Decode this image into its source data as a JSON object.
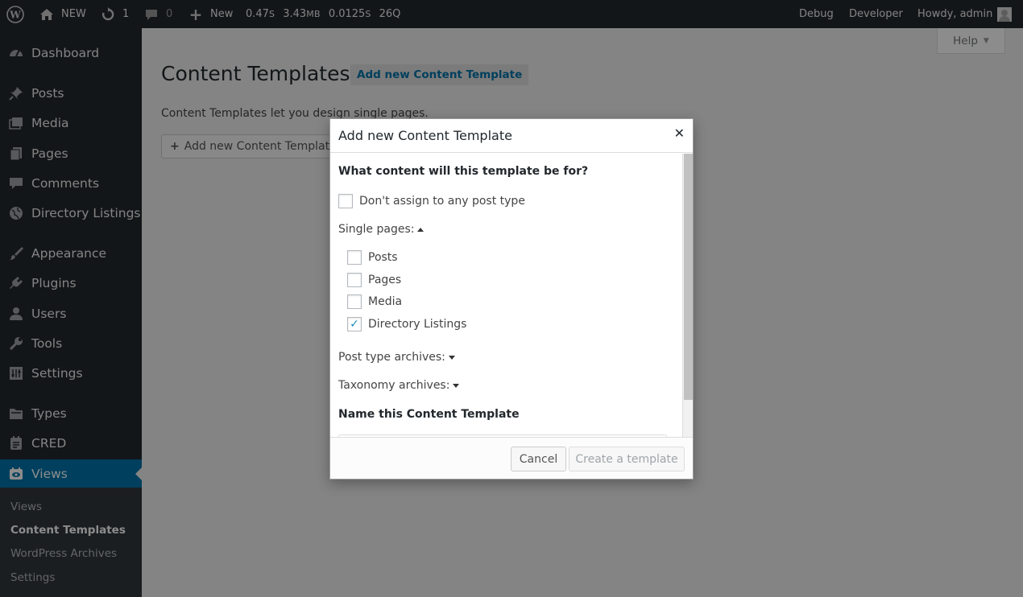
{
  "adminbar": {
    "site_name": "NEW",
    "updates_count": "1",
    "comments_count": "0",
    "new_label": "New",
    "query_time": "0.47",
    "query_time_unit": "S",
    "memory": "3.43",
    "memory_unit": "MB",
    "db_time": "0.0125",
    "db_time_unit": "S",
    "queries": "26Q",
    "debug_label": "Debug",
    "developer_label": "Developer",
    "howdy": "Howdy, admin"
  },
  "sidebar": {
    "items": [
      {
        "label": "Dashboard",
        "icon": "dashboard-icon"
      },
      {
        "label": "Posts",
        "icon": "pushpin-icon"
      },
      {
        "label": "Media",
        "icon": "media-icon"
      },
      {
        "label": "Pages",
        "icon": "pages-icon"
      },
      {
        "label": "Comments",
        "icon": "comment-icon"
      },
      {
        "label": "Directory Listings",
        "icon": "globe-icon"
      },
      {
        "label": "Appearance",
        "icon": "paintbrush-icon"
      },
      {
        "label": "Plugins",
        "icon": "plugin-icon"
      },
      {
        "label": "Users",
        "icon": "user-icon"
      },
      {
        "label": "Tools",
        "icon": "wrench-icon"
      },
      {
        "label": "Settings",
        "icon": "settings-icon"
      },
      {
        "label": "Types",
        "icon": "folder-icon"
      },
      {
        "label": "CRED",
        "icon": "cred-icon"
      },
      {
        "label": "Views",
        "icon": "eye-icon"
      }
    ],
    "submenu": [
      "Views",
      "Content Templates",
      "WordPress Archives",
      "Settings"
    ]
  },
  "content": {
    "help_label": "Help",
    "title": "Content Templates",
    "title_action": "Add new Content Template",
    "intro": "Content Templates let you design single pages.",
    "add_button": "Add new Content Template"
  },
  "dialog": {
    "title": "Add new Content Template",
    "question": "What content will this template be for?",
    "dont_assign": "Don't assign to any post type",
    "single_pages_label": "Single pages:",
    "single_pages": [
      {
        "label": "Posts",
        "checked": false
      },
      {
        "label": "Pages",
        "checked": false
      },
      {
        "label": "Media",
        "checked": false
      },
      {
        "label": "Directory Listings",
        "checked": true
      }
    ],
    "post_type_archives": "Post type archives:",
    "taxonomy_archives": "Taxonomy archives:",
    "name_heading": "Name this Content Template",
    "cancel_label": "Cancel",
    "create_label": "Create a template"
  },
  "colors": {
    "admin_bg": "#23282d",
    "accent": "#0073aa",
    "checkbox_check": "#1e8cbe"
  }
}
